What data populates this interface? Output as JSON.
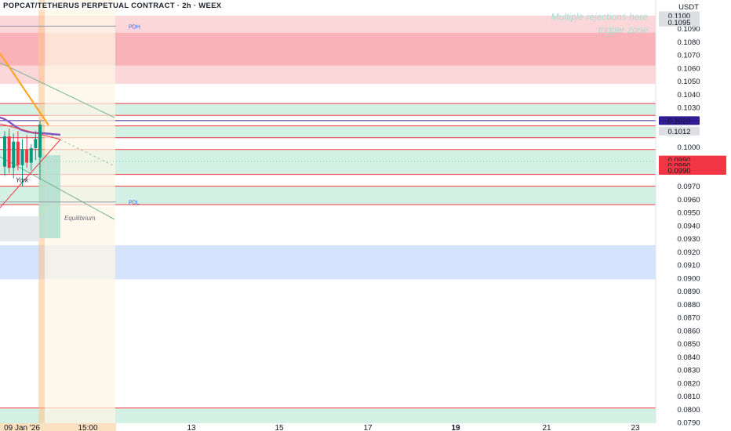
{
  "header": {
    "title": "POPCAT/TETHERUS PERPETUAL CONTRACT · 2h · WEEX"
  },
  "chart_data": {
    "type": "candlestick",
    "title": "POPCAT/TETHERUS PERPETUAL CONTRACT · 2h · WEEX",
    "ylabel": "USDT",
    "ylim": [
      0.079,
      0.11
    ],
    "y_ticks": [
      "0.1090",
      "0.1080",
      "0.1070",
      "0.1060",
      "0.1050",
      "0.1040",
      "0.1030",
      "0.1012",
      "0.1000",
      "0.0970",
      "0.0960",
      "0.0950",
      "0.0940",
      "0.0930",
      "0.0920",
      "0.0910",
      "0.0900",
      "0.0890",
      "0.0880",
      "0.0870",
      "0.0860",
      "0.0850",
      "0.0840",
      "0.0830",
      "0.0820",
      "0.0810",
      "0.0800",
      "0.0790"
    ],
    "x_ticks": [
      "09 Jan '26",
      "15:00",
      "13",
      "15",
      "17",
      "19",
      "21",
      "23"
    ],
    "price_badges": [
      {
        "text": "0.1100",
        "value": 0.11,
        "bg": "#dedfe3",
        "fg": "#131722"
      },
      {
        "text": "0.1095",
        "value": 0.1095,
        "bg": "#dedfe3",
        "fg": "#131722"
      },
      {
        "text": "0.1020",
        "value": 0.102,
        "bg": "#311b92",
        "fg": "#ffffff"
      },
      {
        "text": "0.1012",
        "value": 0.1012,
        "bg": "#dedfe3",
        "fg": "#131722"
      },
      {
        "text": "0.0990",
        "value": 0.099,
        "bg": "#f23645",
        "fg": "#ffffff"
      },
      {
        "text": "0.0990",
        "value": 0.0986,
        "bg": "#f23645",
        "fg": "#ffffff"
      },
      {
        "text": "0.0990",
        "value": 0.0982,
        "bg": "#f23645",
        "fg": "#ffffff"
      }
    ],
    "zones": [
      {
        "kind": "supply",
        "from": 0.1048,
        "to": 0.11,
        "color": "#fcd7d9"
      },
      {
        "kind": "supply-core",
        "from": 0.1062,
        "to": 0.1087,
        "color": "#f9b3b8"
      },
      {
        "kind": "trigger",
        "from": 0.1024,
        "to": 0.1033,
        "color": "#d4f1e6"
      },
      {
        "kind": "fvg",
        "from": 0.1007,
        "to": 0.1016,
        "color": "#d4f1e6"
      },
      {
        "kind": "demand",
        "from": 0.0979,
        "to": 0.0998,
        "color": "#d4f1e6"
      },
      {
        "kind": "demand",
        "from": 0.0956,
        "to": 0.097,
        "color": "#d4f1e6"
      },
      {
        "kind": "blue",
        "from": 0.0899,
        "to": 0.0925,
        "color": "#d6e3fc"
      },
      {
        "kind": "bottom",
        "from": 0.0785,
        "to": 0.0801,
        "color": "#d4f1e6"
      }
    ],
    "levels": [
      {
        "label": "PDH",
        "value": 0.1092
      },
      {
        "label": "PDL",
        "value": 0.0958
      }
    ],
    "annotations": [
      {
        "text": "Multiple rejections here",
        "value": 0.1098,
        "color": "#a9dbd0"
      },
      {
        "text": "trigger zone",
        "value": 0.1094,
        "color": "#a9dbd0"
      },
      {
        "text": "Equilibrium",
        "value": 0.0946,
        "color": "#6a6d78"
      },
      {
        "text": "York",
        "value": 0.0975,
        "color": "#131722"
      }
    ],
    "candles": [
      {
        "o": 0.0985,
        "h": 0.1012,
        "l": 0.0978,
        "c": 0.1008
      },
      {
        "o": 0.1008,
        "h": 0.1014,
        "l": 0.098,
        "c": 0.0984
      },
      {
        "o": 0.0984,
        "h": 0.101,
        "l": 0.0976,
        "c": 0.1004
      },
      {
        "o": 0.1004,
        "h": 0.1012,
        "l": 0.0982,
        "c": 0.0986
      },
      {
        "o": 0.0986,
        "h": 0.1006,
        "l": 0.097,
        "c": 0.0998
      },
      {
        "o": 0.0998,
        "h": 0.1009,
        "l": 0.0984,
        "c": 0.0988
      },
      {
        "o": 0.0988,
        "h": 0.1002,
        "l": 0.0982,
        "c": 0.0999
      },
      {
        "o": 0.0999,
        "h": 0.1012,
        "l": 0.099,
        "c": 0.1006
      },
      {
        "o": 0.0992,
        "h": 0.102,
        "l": 0.0975,
        "c": 0.1017
      }
    ]
  }
}
